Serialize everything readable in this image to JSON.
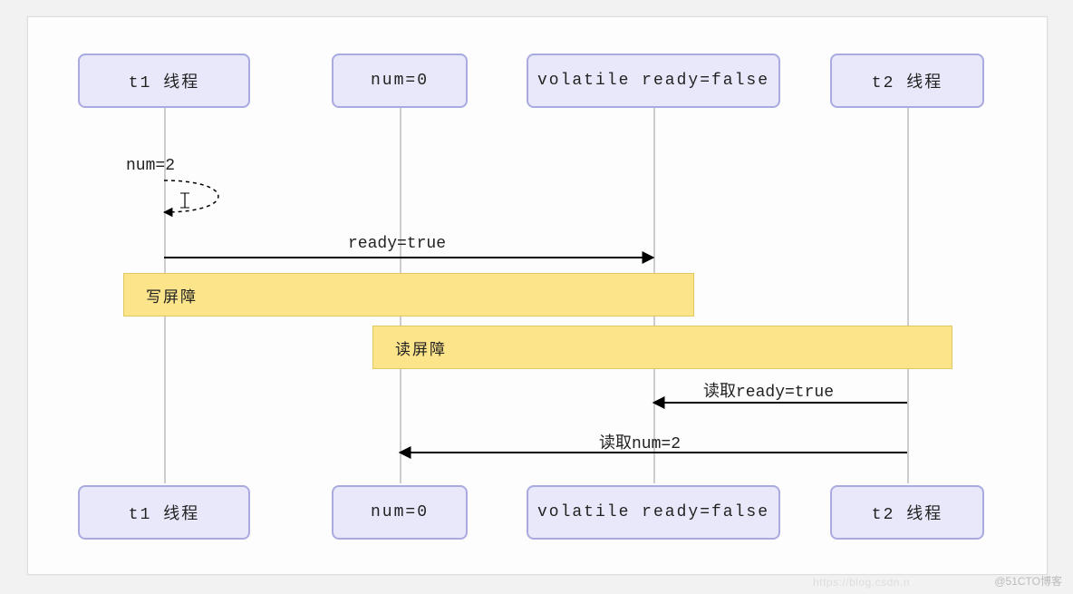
{
  "participants": {
    "t1": "t1 线程",
    "num": "num=0",
    "ready": "volatile ready=false",
    "t2": "t2 线程"
  },
  "messages": {
    "self_num": "num=2",
    "ready_true": "ready=true",
    "read_ready": "读取ready=true",
    "read_num": "读取num=2"
  },
  "barriers": {
    "write": "写屏障",
    "read": "读屏障"
  },
  "watermarks": {
    "csdn": "https://blog.csdn.n",
    "cto": "@51CTO博客"
  },
  "chart_data": {
    "type": "sequence-diagram",
    "participants": [
      {
        "id": "t1",
        "label": "t1 线程"
      },
      {
        "id": "num",
        "label": "num=0"
      },
      {
        "id": "ready",
        "label": "volatile ready=false"
      },
      {
        "id": "t2",
        "label": "t2 线程"
      }
    ],
    "events": [
      {
        "type": "self-message",
        "on": "t1",
        "label": "num=2"
      },
      {
        "type": "message",
        "from": "t1",
        "to": "ready",
        "label": "ready=true"
      },
      {
        "type": "barrier",
        "span": [
          "t1",
          "ready"
        ],
        "label": "写屏障"
      },
      {
        "type": "barrier",
        "span": [
          "num",
          "t2"
        ],
        "label": "读屏障"
      },
      {
        "type": "message",
        "from": "t2",
        "to": "ready",
        "label": "读取ready=true"
      },
      {
        "type": "message",
        "from": "t2",
        "to": "num",
        "label": "读取num=2"
      }
    ]
  }
}
